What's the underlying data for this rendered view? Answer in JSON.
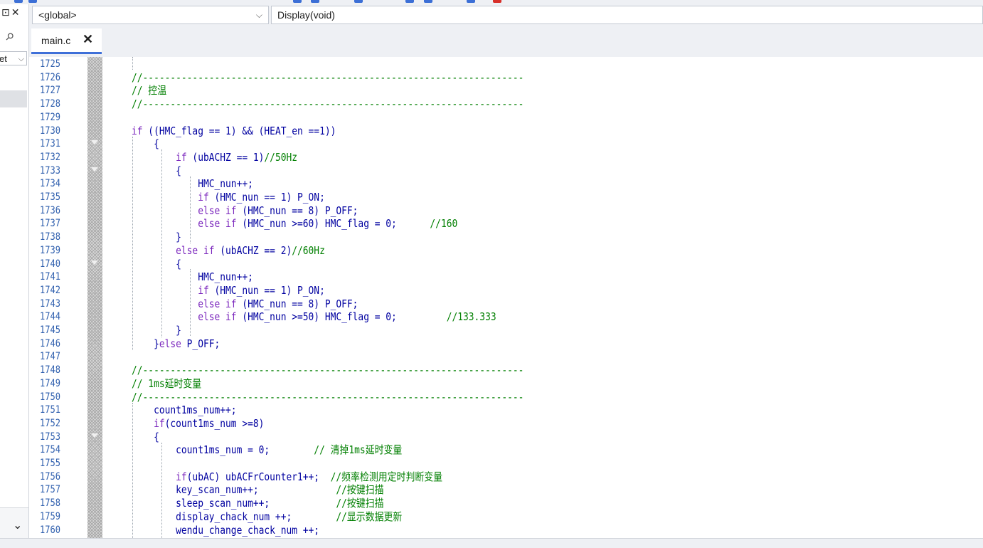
{
  "panel": {
    "float_glyph": "⊡",
    "close_glyph": "✕",
    "pin_glyph": "⚲",
    "select_text": "et",
    "select_chevron": "⌵",
    "bottom_chevron": "⌄"
  },
  "nav": {
    "scope": "<global>",
    "function": "Display(void)",
    "chevron": "⌵"
  },
  "tab": {
    "label": "main.c",
    "close_glyph": "✕"
  },
  "editor": {
    "first_line": 1725,
    "line_numbers": [
      "1725",
      "1726",
      "1727",
      "1728",
      "1729",
      "1730",
      "1731",
      "1732",
      "1733",
      "1734",
      "1735",
      "1736",
      "1737",
      "1738",
      "1739",
      "1740",
      "1741",
      "1742",
      "1743",
      "1744",
      "1745",
      "1746",
      "1747",
      "1748",
      "1749",
      "1750",
      "1751",
      "1752",
      "1753",
      "1754",
      "1755",
      "1756",
      "1757",
      "1758",
      "1759",
      "1760"
    ],
    "fold_marker_lines": [
      1731,
      1733,
      1740,
      1753
    ],
    "lines": [
      [],
      [
        [
          "cm",
          "//---------------------------------------------------------------------"
        ]
      ],
      [
        [
          "cm",
          "// 控温"
        ]
      ],
      [
        [
          "cm",
          "//---------------------------------------------------------------------"
        ]
      ],
      [],
      [
        [
          "kw",
          "if"
        ],
        [
          "id",
          " (("
        ],
        [
          "id",
          "HMC_flag"
        ],
        [
          "id",
          " == 1) && ("
        ],
        [
          "id",
          "HEAT_en"
        ],
        [
          "id",
          " ==1))"
        ]
      ],
      [
        [
          "id",
          "    {"
        ]
      ],
      [
        [
          "kw",
          "        if"
        ],
        [
          "id",
          " (ubACHZ == 1)"
        ],
        [
          "cm",
          "//50Hz"
        ]
      ],
      [
        [
          "id",
          "        {"
        ]
      ],
      [
        [
          "id",
          "            HMC_nun++;"
        ]
      ],
      [
        [
          "kw",
          "            if"
        ],
        [
          "id",
          " (HMC_nun == 1) P_ON;"
        ]
      ],
      [
        [
          "kw",
          "            else if"
        ],
        [
          "id",
          " (HMC_nun == 8) P_OFF;"
        ]
      ],
      [
        [
          "kw",
          "            else if"
        ],
        [
          "id",
          " (HMC_nun >=60) HMC_flag = 0;"
        ],
        [
          "cm",
          "      //160"
        ]
      ],
      [
        [
          "id",
          "        }"
        ]
      ],
      [
        [
          "kw",
          "        else if"
        ],
        [
          "id",
          " (ubACHZ == 2)"
        ],
        [
          "cm",
          "//60Hz"
        ]
      ],
      [
        [
          "id",
          "        {"
        ]
      ],
      [
        [
          "id",
          "            HMC_nun++;"
        ]
      ],
      [
        [
          "kw",
          "            if"
        ],
        [
          "id",
          " (HMC_nun == 1) P_ON;"
        ]
      ],
      [
        [
          "kw",
          "            else if"
        ],
        [
          "id",
          " (HMC_nun == 8) P_OFF;"
        ]
      ],
      [
        [
          "kw",
          "            else if"
        ],
        [
          "id",
          " (HMC_nun >=50) HMC_flag = 0;"
        ],
        [
          "cm",
          "         //133.333"
        ]
      ],
      [
        [
          "id",
          "        }"
        ]
      ],
      [
        [
          "id",
          "    }"
        ],
        [
          "kw",
          "else"
        ],
        [
          "id",
          " P_OFF;"
        ]
      ],
      [],
      [
        [
          "cm",
          "//---------------------------------------------------------------------"
        ]
      ],
      [
        [
          "cm",
          "// 1ms延时变量"
        ]
      ],
      [
        [
          "cm",
          "//---------------------------------------------------------------------"
        ]
      ],
      [
        [
          "id",
          "    count1ms_num++;"
        ]
      ],
      [
        [
          "kw",
          "    if"
        ],
        [
          "id",
          "(count1ms_num >=8)"
        ]
      ],
      [
        [
          "id",
          "    {"
        ]
      ],
      [
        [
          "id",
          "        count1ms_num = 0;"
        ],
        [
          "cm",
          "        // 清掉1ms延时变量"
        ]
      ],
      [],
      [
        [
          "kw",
          "        if"
        ],
        [
          "id",
          "(ubAC) ubACFrCounter1++;"
        ],
        [
          "cm",
          "  //频率检测用定时判断变量"
        ]
      ],
      [
        [
          "id",
          "        key_scan_num++;"
        ],
        [
          "cm",
          "              //按键扫描"
        ]
      ],
      [
        [
          "id",
          "        sleep_scan_num++;"
        ],
        [
          "cm",
          "            //按键扫描"
        ]
      ],
      [
        [
          "id",
          "        display_chack_num ++;"
        ],
        [
          "cm",
          "        //显示数据更新"
        ]
      ],
      [
        [
          "id",
          "        wendu_change_chack_num ++;"
        ]
      ]
    ]
  },
  "colors": {
    "identifier": "#0000a0",
    "keyword": "#7b27bd",
    "comment": "#007f00",
    "line_number": "#2f5fae",
    "tab_accent": "#3e6fd8"
  }
}
